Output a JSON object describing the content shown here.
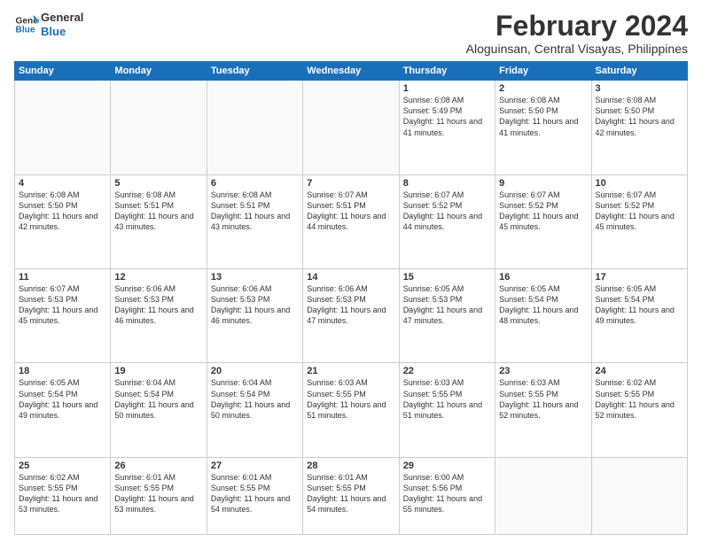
{
  "logo": {
    "line1": "General",
    "line2": "Blue"
  },
  "title": "February 2024",
  "subtitle": "Aloguinsan, Central Visayas, Philippines",
  "headers": [
    "Sunday",
    "Monday",
    "Tuesday",
    "Wednesday",
    "Thursday",
    "Friday",
    "Saturday"
  ],
  "weeks": [
    [
      {
        "day": "",
        "info": ""
      },
      {
        "day": "",
        "info": ""
      },
      {
        "day": "",
        "info": ""
      },
      {
        "day": "",
        "info": ""
      },
      {
        "day": "1",
        "info": "Sunrise: 6:08 AM\nSunset: 5:49 PM\nDaylight: 11 hours and 41 minutes."
      },
      {
        "day": "2",
        "info": "Sunrise: 6:08 AM\nSunset: 5:50 PM\nDaylight: 11 hours and 41 minutes."
      },
      {
        "day": "3",
        "info": "Sunrise: 6:08 AM\nSunset: 5:50 PM\nDaylight: 11 hours and 42 minutes."
      }
    ],
    [
      {
        "day": "4",
        "info": "Sunrise: 6:08 AM\nSunset: 5:50 PM\nDaylight: 11 hours and 42 minutes."
      },
      {
        "day": "5",
        "info": "Sunrise: 6:08 AM\nSunset: 5:51 PM\nDaylight: 11 hours and 43 minutes."
      },
      {
        "day": "6",
        "info": "Sunrise: 6:08 AM\nSunset: 5:51 PM\nDaylight: 11 hours and 43 minutes."
      },
      {
        "day": "7",
        "info": "Sunrise: 6:07 AM\nSunset: 5:51 PM\nDaylight: 11 hours and 44 minutes."
      },
      {
        "day": "8",
        "info": "Sunrise: 6:07 AM\nSunset: 5:52 PM\nDaylight: 11 hours and 44 minutes."
      },
      {
        "day": "9",
        "info": "Sunrise: 6:07 AM\nSunset: 5:52 PM\nDaylight: 11 hours and 45 minutes."
      },
      {
        "day": "10",
        "info": "Sunrise: 6:07 AM\nSunset: 5:52 PM\nDaylight: 11 hours and 45 minutes."
      }
    ],
    [
      {
        "day": "11",
        "info": "Sunrise: 6:07 AM\nSunset: 5:53 PM\nDaylight: 11 hours and 45 minutes."
      },
      {
        "day": "12",
        "info": "Sunrise: 6:06 AM\nSunset: 5:53 PM\nDaylight: 11 hours and 46 minutes."
      },
      {
        "day": "13",
        "info": "Sunrise: 6:06 AM\nSunset: 5:53 PM\nDaylight: 11 hours and 46 minutes."
      },
      {
        "day": "14",
        "info": "Sunrise: 6:06 AM\nSunset: 5:53 PM\nDaylight: 11 hours and 47 minutes."
      },
      {
        "day": "15",
        "info": "Sunrise: 6:05 AM\nSunset: 5:53 PM\nDaylight: 11 hours and 47 minutes."
      },
      {
        "day": "16",
        "info": "Sunrise: 6:05 AM\nSunset: 5:54 PM\nDaylight: 11 hours and 48 minutes."
      },
      {
        "day": "17",
        "info": "Sunrise: 6:05 AM\nSunset: 5:54 PM\nDaylight: 11 hours and 49 minutes."
      }
    ],
    [
      {
        "day": "18",
        "info": "Sunrise: 6:05 AM\nSunset: 5:54 PM\nDaylight: 11 hours and 49 minutes."
      },
      {
        "day": "19",
        "info": "Sunrise: 6:04 AM\nSunset: 5:54 PM\nDaylight: 11 hours and 50 minutes."
      },
      {
        "day": "20",
        "info": "Sunrise: 6:04 AM\nSunset: 5:54 PM\nDaylight: 11 hours and 50 minutes."
      },
      {
        "day": "21",
        "info": "Sunrise: 6:03 AM\nSunset: 5:55 PM\nDaylight: 11 hours and 51 minutes."
      },
      {
        "day": "22",
        "info": "Sunrise: 6:03 AM\nSunset: 5:55 PM\nDaylight: 11 hours and 51 minutes."
      },
      {
        "day": "23",
        "info": "Sunrise: 6:03 AM\nSunset: 5:55 PM\nDaylight: 11 hours and 52 minutes."
      },
      {
        "day": "24",
        "info": "Sunrise: 6:02 AM\nSunset: 5:55 PM\nDaylight: 11 hours and 52 minutes."
      }
    ],
    [
      {
        "day": "25",
        "info": "Sunrise: 6:02 AM\nSunset: 5:55 PM\nDaylight: 11 hours and 53 minutes."
      },
      {
        "day": "26",
        "info": "Sunrise: 6:01 AM\nSunset: 5:55 PM\nDaylight: 11 hours and 53 minutes."
      },
      {
        "day": "27",
        "info": "Sunrise: 6:01 AM\nSunset: 5:55 PM\nDaylight: 11 hours and 54 minutes."
      },
      {
        "day": "28",
        "info": "Sunrise: 6:01 AM\nSunset: 5:55 PM\nDaylight: 11 hours and 54 minutes."
      },
      {
        "day": "29",
        "info": "Sunrise: 6:00 AM\nSunset: 5:56 PM\nDaylight: 11 hours and 55 minutes."
      },
      {
        "day": "",
        "info": ""
      },
      {
        "day": "",
        "info": ""
      }
    ]
  ]
}
